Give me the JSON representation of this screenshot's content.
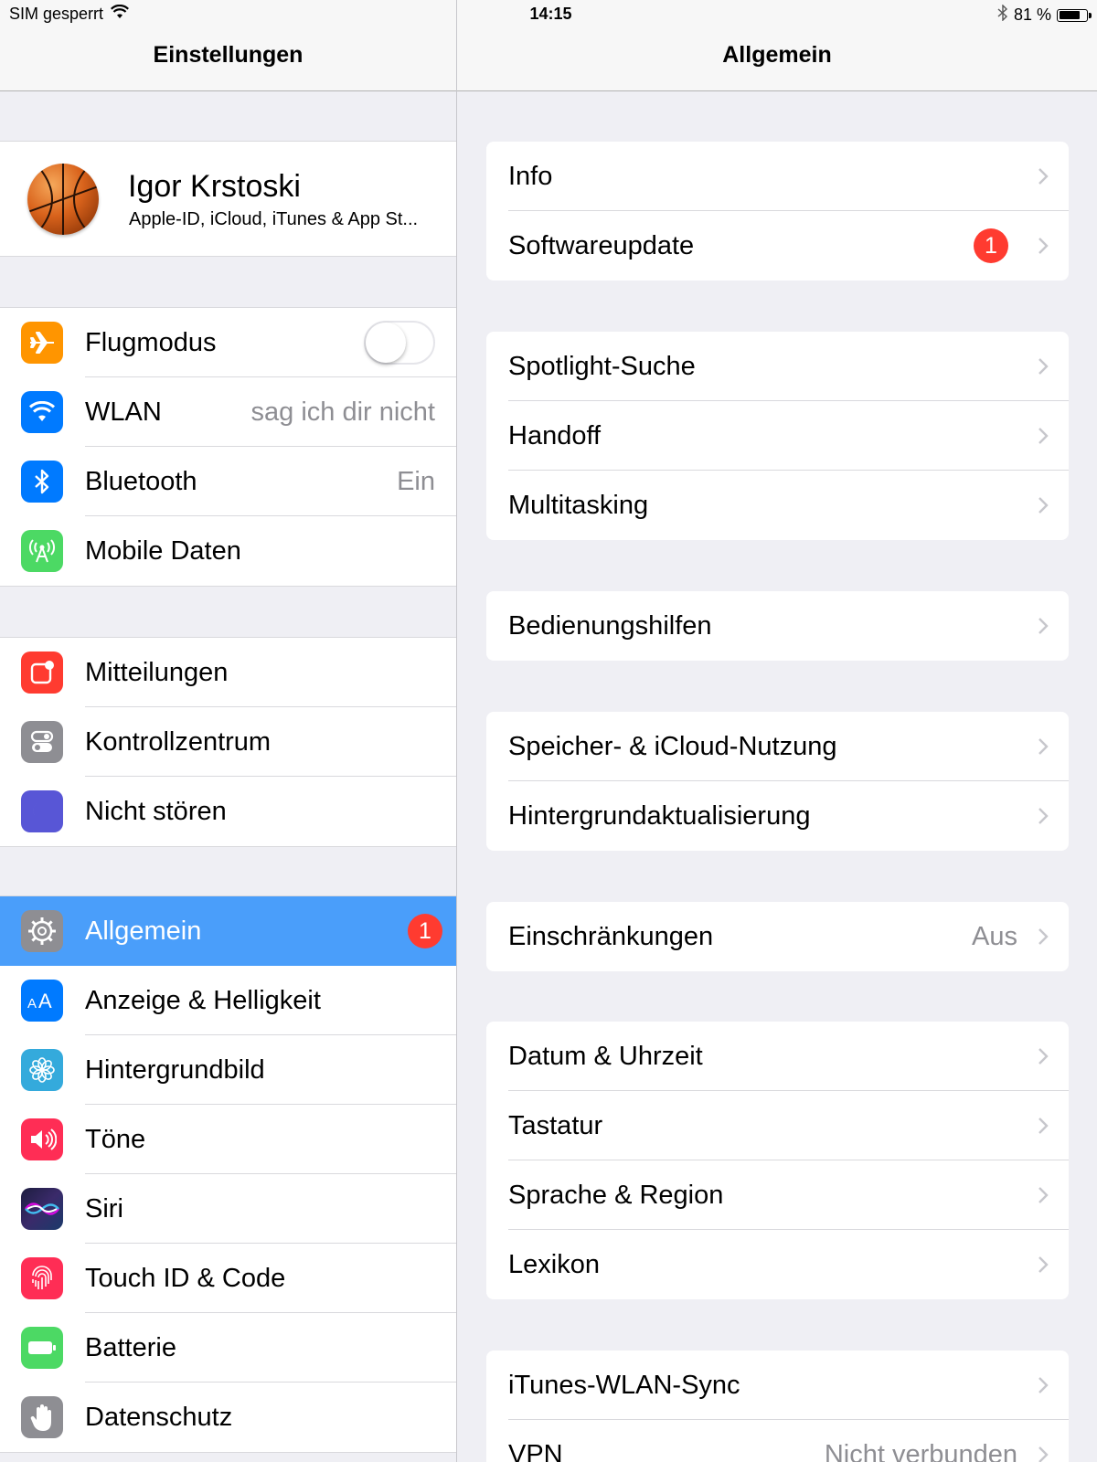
{
  "status_bar": {
    "carrier": "SIM gesperrt",
    "time": "14:15",
    "battery": "81 %",
    "battery_level": 0.81
  },
  "left": {
    "title": "Einstellungen",
    "profile": {
      "name": "Igor Krstoski",
      "subtitle": "Apple-ID, iCloud, iTunes & App St..."
    },
    "group1": [
      {
        "label": "Flugmodus",
        "icon": "airplane-icon",
        "color": "#ff9500",
        "toggle_on": false
      },
      {
        "label": "WLAN",
        "icon": "wifi-icon",
        "color": "#007aff",
        "value": "sag ich dir nicht"
      },
      {
        "label": "Bluetooth",
        "icon": "bluetooth-icon",
        "color": "#007aff",
        "value": "Ein"
      },
      {
        "label": "Mobile Daten",
        "icon": "antenna-icon",
        "color": "#4cd964"
      }
    ],
    "group2": [
      {
        "label": "Mitteilungen",
        "icon": "notifications-icon",
        "color": "#ff3b30"
      },
      {
        "label": "Kontrollzentrum",
        "icon": "control-center-icon",
        "color": "#8e8e93"
      },
      {
        "label": "Nicht stören",
        "icon": "moon-icon",
        "color": "#5856d6"
      }
    ],
    "group3": [
      {
        "label": "Allgemein",
        "icon": "gear-icon",
        "color": "#8e8e93",
        "badge": "1",
        "selected": true
      },
      {
        "label": "Anzeige & Helligkeit",
        "icon": "text-size-icon",
        "color": "#007aff"
      },
      {
        "label": "Hintergrundbild",
        "icon": "flower-icon",
        "color": "#34aadc"
      },
      {
        "label": "Töne",
        "icon": "speaker-icon",
        "color": "#ff2d55"
      },
      {
        "label": "Siri",
        "icon": "siri-icon",
        "color": "#1c1c3a"
      },
      {
        "label": "Touch ID & Code",
        "icon": "fingerprint-icon",
        "color": "#ff2d55"
      },
      {
        "label": "Batterie",
        "icon": "battery-icon",
        "color": "#4cd964"
      },
      {
        "label": "Datenschutz",
        "icon": "hand-icon",
        "color": "#8e8e93"
      }
    ]
  },
  "right": {
    "title": "Allgemein",
    "groups": [
      [
        {
          "label": "Info"
        },
        {
          "label": "Softwareupdate",
          "badge": "1"
        }
      ],
      [
        {
          "label": "Spotlight-Suche"
        },
        {
          "label": "Handoff"
        },
        {
          "label": "Multitasking"
        }
      ],
      [
        {
          "label": "Bedienungshilfen"
        }
      ],
      [
        {
          "label": "Speicher- & iCloud-Nutzung"
        },
        {
          "label": "Hintergrundaktualisierung"
        }
      ],
      [
        {
          "label": "Einschränkungen",
          "value": "Aus"
        }
      ],
      [
        {
          "label": "Datum & Uhrzeit"
        },
        {
          "label": "Tastatur"
        },
        {
          "label": "Sprache & Region"
        },
        {
          "label": "Lexikon"
        }
      ],
      [
        {
          "label": "iTunes-WLAN-Sync"
        },
        {
          "label": "VPN",
          "value": "Nicht verbunden"
        }
      ]
    ]
  }
}
